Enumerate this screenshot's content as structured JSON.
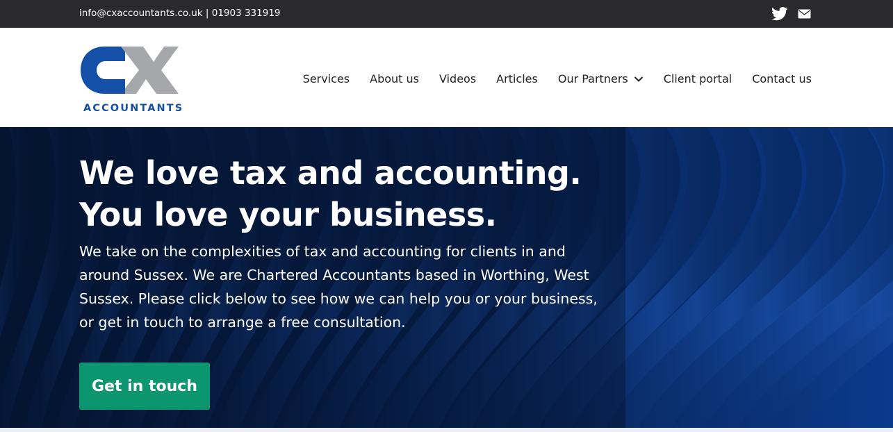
{
  "topbar": {
    "email": "info@cxaccountants.co.uk",
    "separator": "|",
    "phone": "01903 331919",
    "icons": [
      "twitter-icon",
      "mail-icon"
    ]
  },
  "brand": {
    "logo_text": "ACCOUNTANTS",
    "primary_color": "#1550a8",
    "secondary_color": "#a6a7ab"
  },
  "nav": {
    "items": [
      {
        "label": "Services"
      },
      {
        "label": "About us"
      },
      {
        "label": "Videos"
      },
      {
        "label": "Articles"
      },
      {
        "label": "Our Partners",
        "icon": "chevron-down-icon"
      },
      {
        "label": "Client portal"
      },
      {
        "label": "Contact us"
      }
    ]
  },
  "hero": {
    "title_line1": "We love tax and accounting.",
    "title_line2": "You love your business.",
    "body": "We take on the complexities of tax and accounting for clients in and around Sussex. We are Chartered Accountants based in Worthing, West Sussex. Please click below to see how we can help you or your business, or get in touch to arrange a free consultation.",
    "cta_label": "Get in touch",
    "cta_color": "#0c9670"
  }
}
